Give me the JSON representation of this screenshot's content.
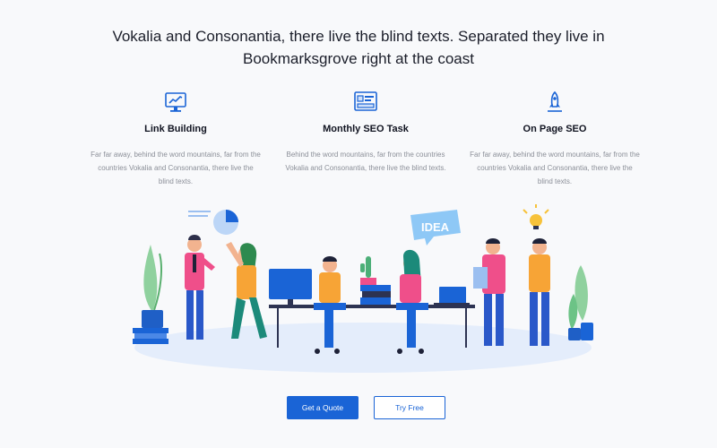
{
  "headline": {
    "line1": "Vokalia and Consonantia, there live the blind texts. Separated they live in",
    "line2": "Bookmarksgrove right at the coast"
  },
  "features": [
    {
      "icon": "monitor-chart-icon",
      "title": "Link Building",
      "desc": "Far far away, behind the word mountains, far from the countries Vokalia and Consonantia, there live the blind texts."
    },
    {
      "icon": "dashboard-icon",
      "title": "Monthly SEO Task",
      "desc": "Behind the word mountains, far from the countries Vokalia and Consonantia, there live the blind texts."
    },
    {
      "icon": "rocket-icon",
      "title": "On Page SEO",
      "desc": "Far far away, behind the word mountains, far from the countries Vokalia and Consonantia, there live the blind texts."
    }
  ],
  "illustration": {
    "bubble_text": "IDEA"
  },
  "buttons": {
    "primary": "Get a Quote",
    "secondary": "Try Free"
  },
  "colors": {
    "accent": "#1a64d6",
    "background": "#f8f9fb",
    "muted_text": "#8b8f98"
  }
}
